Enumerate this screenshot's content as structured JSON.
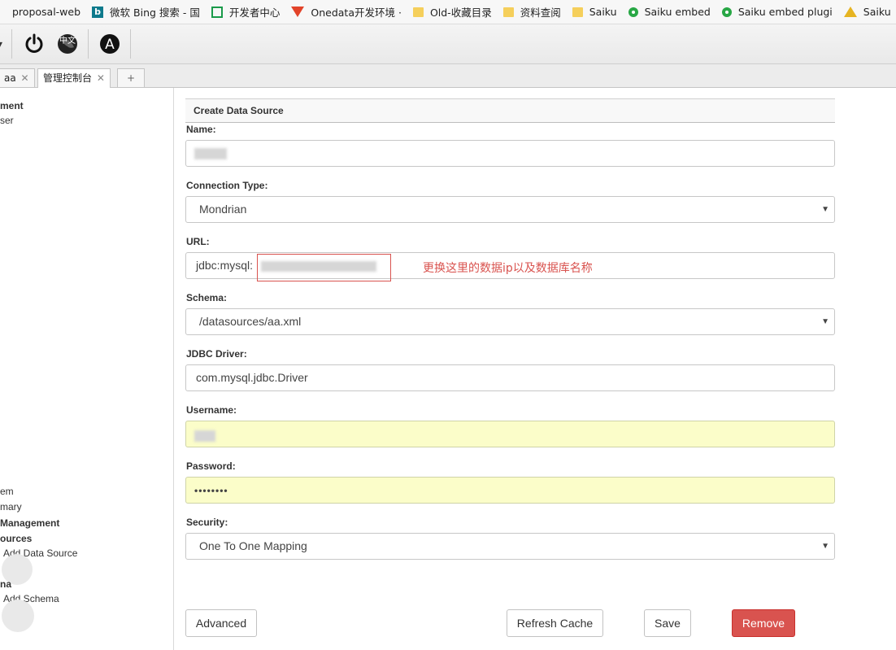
{
  "bookmarks": [
    {
      "label": "proposal-web",
      "icon": "none"
    },
    {
      "label": "微软 Bing 搜索 - 国",
      "icon": "bing-icon"
    },
    {
      "label": "开发者中心",
      "icon": "square-icon"
    },
    {
      "label": "Onedata开发环境 ·",
      "icon": "gitlab-icon"
    },
    {
      "label": "Old-收藏目录",
      "icon": "folder-icon"
    },
    {
      "label": "资料查阅",
      "icon": "folder-icon"
    },
    {
      "label": "Saiku",
      "icon": "folder-icon"
    },
    {
      "label": "Saiku embed",
      "icon": "saiku-icon"
    },
    {
      "label": "Saiku embed plugi",
      "icon": "saiku-icon"
    },
    {
      "label": "Saiku",
      "icon": "saiku-yellow-icon"
    }
  ],
  "toolbar": {
    "globe_text": "中文",
    "user_letter": "A"
  },
  "tabs": [
    {
      "label": "aa",
      "close": "✕"
    },
    {
      "label": "管理控制台",
      "close": "✕"
    },
    {
      "label": "+"
    }
  ],
  "left_panel": {
    "items": [
      "ment",
      "ser",
      "em",
      "mary",
      "Management",
      "ources",
      "Add Data Source",
      "na",
      "Add Schema"
    ]
  },
  "form": {
    "header": "Create Data Source",
    "name_label": "Name:",
    "connection_type_label": "Connection Type:",
    "connection_type_value": "Mondrian",
    "url_label": "URL:",
    "url_prefix": "jdbc:mysql:",
    "annotation": "更换这里的数据ip以及数据库名称",
    "schema_label": "Schema:",
    "schema_value": "/datasources/aa.xml",
    "jdbc_driver_label": "JDBC Driver:",
    "jdbc_driver_value": "com.mysql.jdbc.Driver",
    "username_label": "Username:",
    "password_label": "Password:",
    "password_value": "••••••••",
    "security_label": "Security:",
    "security_value": "One To One Mapping",
    "caret": "▼"
  },
  "buttons": {
    "advanced": "Advanced",
    "refresh_cache": "Refresh Cache",
    "save": "Save",
    "remove": "Remove"
  },
  "colors": {
    "danger": "#d9534f",
    "autofill": "#fbfdc9"
  }
}
